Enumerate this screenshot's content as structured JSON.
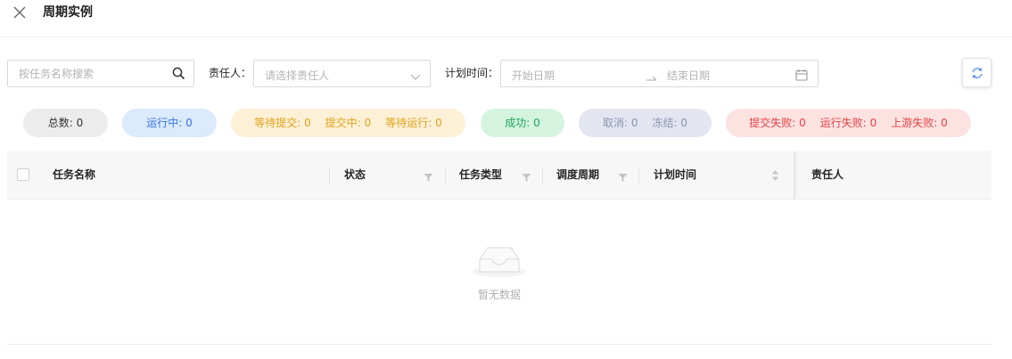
{
  "header": {
    "title": "周期实例",
    "close_icon": "close-icon"
  },
  "filters": {
    "search_placeholder": "按任务名称搜索",
    "owner_label": "责任人：",
    "owner_placeholder": "请选择责任人",
    "time_label": "计划时间：",
    "start_placeholder": "开始日期",
    "end_placeholder": "结束日期",
    "refresh_icon": "refresh-icon"
  },
  "stats": {
    "total": "总数: 0",
    "running": "运行中: 0",
    "waiting_submit": "等待提交: 0",
    "submitting": "提交中: 0",
    "waiting_run": "等待运行: 0",
    "success": "成功: 0",
    "cancelled": "取消: 0",
    "frozen": "冻结: 0",
    "submit_failed": "提交失败: 0",
    "run_failed": "运行失败: 0",
    "upstream_failed": "上游失败: 0"
  },
  "table": {
    "columns": [
      "任务名称",
      "状态",
      "任务类型",
      "调度周期",
      "计划时间",
      "责任人"
    ],
    "rows": [],
    "empty_text": "暂无数据"
  },
  "colors": {
    "running": "#3574e0",
    "waiting": "#e0a21b",
    "success": "#23a55a",
    "cancelled": "#8b93ad",
    "failed": "#e84040"
  }
}
